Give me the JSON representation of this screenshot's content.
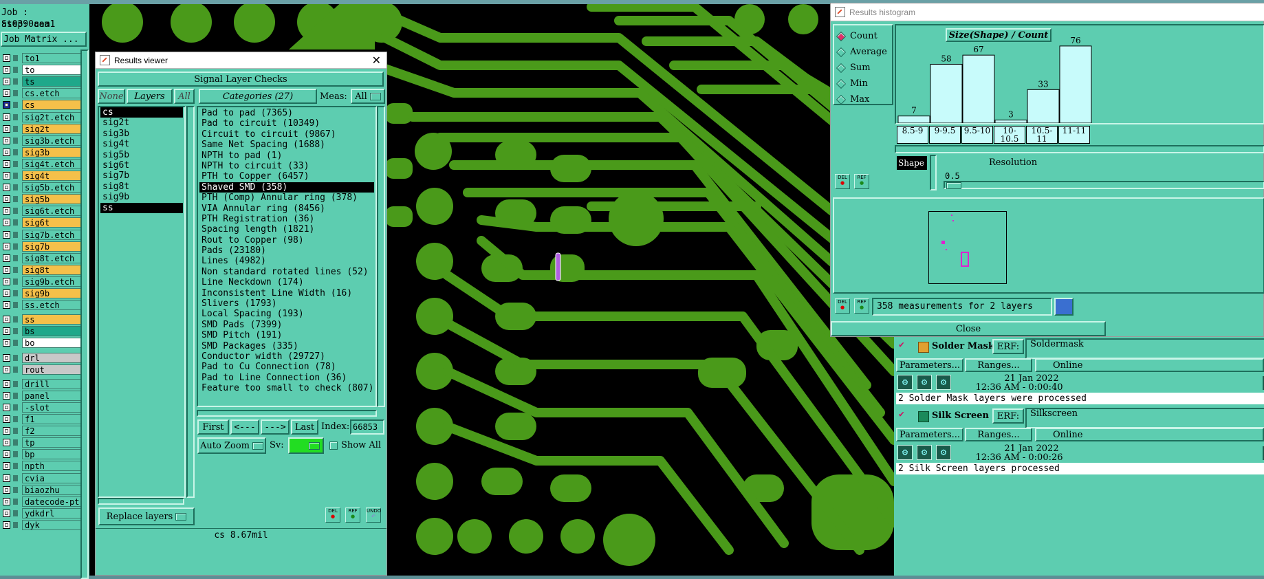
{
  "job": {
    "job_label": "Job : as0390aea1",
    "step_label": "Step: cam",
    "matrix_button": "Job Matrix ..."
  },
  "layers": [
    {
      "name": "to1",
      "color": "#5dcdb0"
    },
    {
      "name": "to",
      "color": "#ffffff"
    },
    {
      "name": "ts",
      "color": "#1fa88a"
    },
    {
      "name": "cs.etch",
      "color": "#5dcdb0"
    },
    {
      "name": "cs",
      "color": "#f5c04a",
      "active": true
    },
    {
      "name": "sig2t.etch",
      "color": "#5dcdb0"
    },
    {
      "name": "sig2t",
      "color": "#f5c04a"
    },
    {
      "name": "sig3b.etch",
      "color": "#5dcdb0"
    },
    {
      "name": "sig3b",
      "color": "#f5c04a"
    },
    {
      "name": "sig4t.etch",
      "color": "#5dcdb0"
    },
    {
      "name": "sig4t",
      "color": "#f5c04a"
    },
    {
      "name": "sig5b.etch",
      "color": "#5dcdb0"
    },
    {
      "name": "sig5b",
      "color": "#f5c04a"
    },
    {
      "name": "sig6t.etch",
      "color": "#5dcdb0"
    },
    {
      "name": "sig6t",
      "color": "#f5c04a"
    },
    {
      "name": "sig7b.etch",
      "color": "#5dcdb0"
    },
    {
      "name": "sig7b",
      "color": "#f5c04a"
    },
    {
      "name": "sig8t.etch",
      "color": "#5dcdb0"
    },
    {
      "name": "sig8t",
      "color": "#f5c04a"
    },
    {
      "name": "sig9b.etch",
      "color": "#5dcdb0"
    },
    {
      "name": "sig9b",
      "color": "#f5c04a"
    },
    {
      "name": "ss.etch",
      "color": "#5dcdb0"
    },
    {
      "name": "ss",
      "color": "#f5c04a"
    },
    {
      "name": "bs",
      "color": "#1fa88a"
    },
    {
      "name": "bo",
      "color": "#ffffff"
    },
    {
      "name": "drl",
      "color": "#c8c8c8"
    },
    {
      "name": "rout",
      "color": "#c8c8c8"
    },
    {
      "name": "drill",
      "color": "#5dcdb0"
    },
    {
      "name": "panel",
      "color": "#5dcdb0"
    },
    {
      "name": "-slot",
      "color": "#5dcdb0"
    },
    {
      "name": "f1",
      "color": "#5dcdb0"
    },
    {
      "name": "f2",
      "color": "#5dcdb0"
    },
    {
      "name": "tp",
      "color": "#5dcdb0"
    },
    {
      "name": "bp",
      "color": "#5dcdb0"
    },
    {
      "name": "npth",
      "color": "#5dcdb0"
    },
    {
      "name": "cvia",
      "color": "#5dcdb0"
    },
    {
      "name": "biaozhu",
      "color": "#5dcdb0"
    },
    {
      "name": "datecode-pt",
      "color": "#5dcdb0"
    },
    {
      "name": "ydkdrl",
      "color": "#5dcdb0"
    },
    {
      "name": "dyk",
      "color": "#5dcdb0"
    }
  ],
  "results_viewer": {
    "title": "Results viewer",
    "header": "Signal Layer Checks",
    "none_btn": "None",
    "layers_btn": "Layers",
    "all_btn": "All",
    "categories_btn": "Categories (27)",
    "meas_label": "Meas:",
    "meas_value": "All",
    "layer_list": [
      "cs",
      "sig2t",
      "sig3b",
      "sig4t",
      "sig5b",
      "sig6t",
      "sig7b",
      "sig8t",
      "sig9b",
      "ss"
    ],
    "categories": [
      "Pad to pad (7365)",
      "Pad to circuit (10349)",
      "Circuit to circuit (9867)",
      "Same Net Spacing (1688)",
      "NPTH to pad (1)",
      "NPTH to circuit (33)",
      "PTH to Copper (6457)",
      "Shaved SMD (358)",
      "PTH (Comp) Annular ring (378)",
      "VIA Annular ring (8456)",
      "PTH Registration (36)",
      "Spacing length (1821)",
      "Rout to Copper (98)",
      "Pads (23180)",
      "Lines (4982)",
      "Non standard rotated lines (52)",
      "Line Neckdown (174)",
      "Inconsistent Line Width (16)",
      "Slivers (1793)",
      "Local Spacing (193)",
      "SMD Pads (7399)",
      "SMD Pitch (191)",
      "SMD Packages (335)",
      "Conductor width (29727)",
      "Pad to Cu Connection (78)",
      "Pad to Line Connection (36)",
      "Feature too small to check (807)"
    ],
    "first_btn": "First",
    "prev_btn": "<---",
    "next_btn": "--->",
    "last_btn": "Last",
    "index_label": "Index:",
    "index_value": "66853",
    "auto_zoom": "Auto Zoom",
    "sv_label": "Sv:",
    "sv_color": "#22dd22",
    "show_all": "Show All",
    "replace_layers": "Replace layers",
    "del_label": "DEL",
    "ref_label": "REF",
    "undo_label": "UNDO",
    "status": "cs 8.67mil"
  },
  "histogram": {
    "title": "Results histogram",
    "modes": [
      "Count",
      "Average",
      "Sum",
      "Min",
      "Max"
    ],
    "chart_title": "Size(Shape) / Count",
    "bars": [
      {
        "range": "8.5-9",
        "count": 7
      },
      {
        "range": "9-9.5",
        "count": 58
      },
      {
        "range": "9.5-10",
        "count": 67
      },
      {
        "range": "10-10.5",
        "count": 3
      },
      {
        "range": "10.5-11",
        "count": 33
      },
      {
        "range": "11-11",
        "count": 76
      }
    ],
    "shape_btn": "Shape",
    "resolution_label": "Resolution",
    "resolution_value": "0.5",
    "measurements": "358 measurements for 2 layers",
    "close_btn": "Close",
    "del_label": "DEL",
    "ref_label": "REF"
  },
  "checks": {
    "solder": {
      "title": "Solder Mask Ch",
      "erf_label": "ERF:",
      "erf_value": "Soldermask",
      "params": "Parameters...",
      "ranges": "Ranges...",
      "online": "Online",
      "date": "21 Jan 2022",
      "time": "12:36 AM - 0:00:40",
      "message": "2 Solder Mask layers were processed"
    },
    "silk": {
      "title": "Silk Screen Che",
      "erf_label": "ERF:",
      "erf_value": "Silkscreen",
      "params": "Parameters...",
      "ranges": "Ranges...",
      "online": "Online",
      "date": "21 Jan 2022",
      "time": "12:36 AM - 0:00:26",
      "message": "2 Silk Screen layers processed"
    }
  },
  "canvas_color": {
    "copper": "#4a9a1a",
    "background": "#000000",
    "highlight": "#b060e0"
  }
}
